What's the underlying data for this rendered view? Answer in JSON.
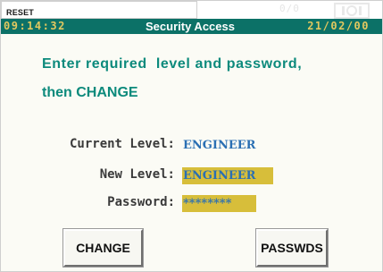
{
  "header": {
    "reset_label": "RESET",
    "alarm_count": "0/0",
    "alarm_icon": "alarm-bell-icon"
  },
  "titlebar": {
    "time": "09:14:32",
    "title": "Security Access",
    "date": "21/02/00"
  },
  "prompt": {
    "line1": "Enter required  level and password,",
    "line2": "then CHANGE"
  },
  "fields": {
    "current_level_label": "Current Level:",
    "current_level_value": "ENGINEER",
    "new_level_label": "New Level:",
    "new_level_value": "ENGINEER",
    "password_label": "Password:",
    "password_value": "********"
  },
  "buttons": {
    "change_label": "CHANGE",
    "passwds_label": "PASSWDS"
  },
  "colors": {
    "titlebar_bg": "#0c7167",
    "titlebar_time_date": "#e2c85f",
    "prompt_text": "#0c8a7c",
    "value_text": "#2a6fb3",
    "editable_field_bg": "#d7be3a"
  }
}
